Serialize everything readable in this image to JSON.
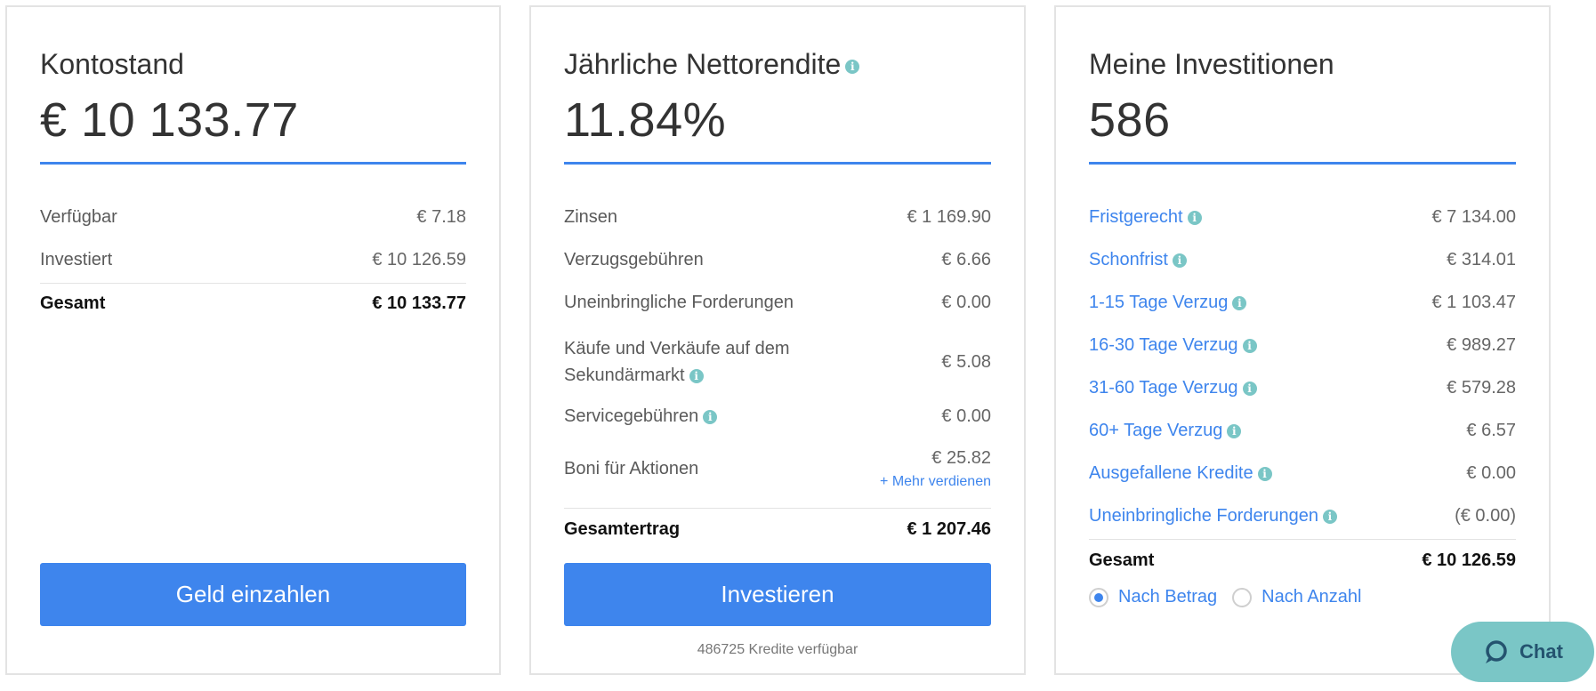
{
  "balance_card": {
    "title": "Kontostand",
    "value": "€ 10 133.77",
    "rows": [
      {
        "label": "Verfügbar",
        "amount": "€ 7.18"
      },
      {
        "label": "Investiert",
        "amount": "€ 10 126.59"
      }
    ],
    "total": {
      "label": "Gesamt",
      "amount": "€ 10 133.77"
    },
    "button_label": "Geld einzahlen"
  },
  "return_card": {
    "title": "Jährliche Nettorendite",
    "value": "11.84%",
    "rows": [
      {
        "label": "Zinsen",
        "amount": "€ 1 169.90"
      },
      {
        "label": "Verzugsgebühren",
        "amount": "€ 6.66"
      },
      {
        "label": "Uneinbringliche Forderungen",
        "amount": "€ 0.00"
      },
      {
        "label_line1": "Käufe und Verkäufe auf dem",
        "label_line2": "Sekundärmarkt",
        "amount": "€ 5.08"
      },
      {
        "label": "Servicegebühren",
        "amount": "€ 0.00"
      },
      {
        "label": "Boni für Aktionen",
        "amount": "€ 25.82",
        "link": "+ Mehr verdienen"
      }
    ],
    "total": {
      "label": "Gesamtertrag",
      "amount": "€ 1 207.46"
    },
    "button_label": "Investieren",
    "available_text": "486725 Kredite verfügbar"
  },
  "investments_card": {
    "title": "Meine Investitionen",
    "value": "586",
    "rows": [
      {
        "label": "Fristgerecht",
        "amount": "€ 7 134.00"
      },
      {
        "label": "Schonfrist",
        "amount": "€ 314.01"
      },
      {
        "label": "1-15 Tage Verzug",
        "amount": "€ 1 103.47"
      },
      {
        "label": "16-30 Tage Verzug",
        "amount": "€ 989.27"
      },
      {
        "label": "31-60 Tage Verzug",
        "amount": "€ 579.28"
      },
      {
        "label": "60+ Tage Verzug",
        "amount": "€ 6.57"
      },
      {
        "label": "Ausgefallene Kredite",
        "amount": "€ 0.00"
      },
      {
        "label": "Uneinbringliche Forderungen",
        "amount": "(€ 0.00)"
      }
    ],
    "total": {
      "label": "Gesamt",
      "amount": "€ 10 126.59"
    },
    "radio_options": [
      {
        "label": "Nach Betrag",
        "selected": true
      },
      {
        "label": "Nach Anzahl",
        "selected": false
      }
    ]
  },
  "chat": {
    "label": "Chat",
    "icon": "chat-bubble-icon"
  },
  "colors": {
    "accent": "#3e85ed",
    "info": "#7ac6c6",
    "chat_bg": "#7ac6c6"
  },
  "info_icon_glyph": "i"
}
